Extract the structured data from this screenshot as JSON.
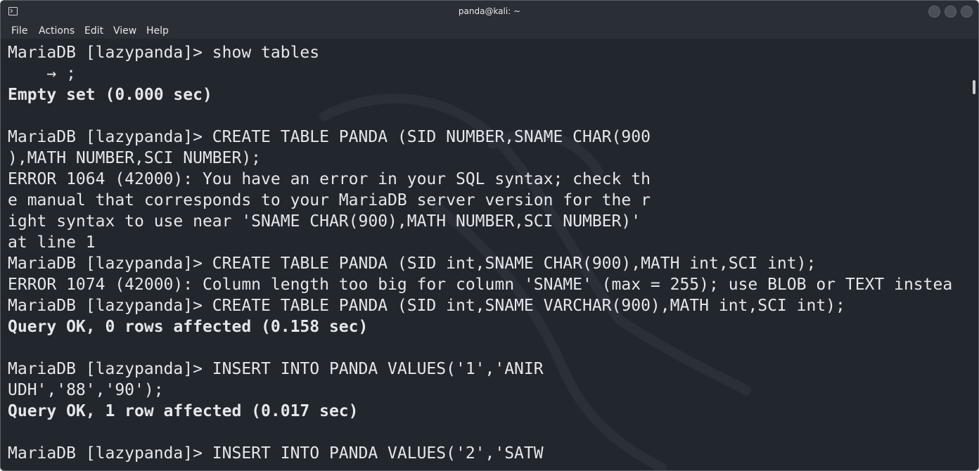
{
  "window": {
    "title": "panda@kali: ~"
  },
  "menu": [
    "File",
    "Actions",
    "Edit",
    "View",
    "Help"
  ],
  "terminal": {
    "lines": [
      {
        "text": "MariaDB [lazypanda]> show tables",
        "bold": false
      },
      {
        "text": "    → ;",
        "bold": false
      },
      {
        "text": "Empty set (0.000 sec)",
        "bold": true
      },
      {
        "text": "",
        "bold": false
      },
      {
        "text": "MariaDB [lazypanda]> CREATE TABLE PANDA (SID NUMBER,SNAME CHAR(900",
        "bold": false
      },
      {
        "text": "),MATH NUMBER,SCI NUMBER);",
        "bold": false
      },
      {
        "text": "ERROR 1064 (42000): You have an error in your SQL syntax; check th",
        "bold": false
      },
      {
        "text": "e manual that corresponds to your MariaDB server version for the r",
        "bold": false
      },
      {
        "text": "ight syntax to use near 'SNAME CHAR(900),MATH NUMBER,SCI NUMBER)'",
        "bold": false
      },
      {
        "text": "at line 1",
        "bold": false
      },
      {
        "text": "MariaDB [lazypanda]> CREATE TABLE PANDA (SID int,SNAME CHAR(900),MATH int,SCI int);",
        "bold": false
      },
      {
        "text": "ERROR 1074 (42000): Column length too big for column 'SNAME' (max = 255); use BLOB or TEXT instea",
        "bold": false
      },
      {
        "text": "MariaDB [lazypanda]> CREATE TABLE PANDA (SID int,SNAME VARCHAR(900),MATH int,SCI int);",
        "bold": false
      },
      {
        "text": "Query OK, 0 rows affected (0.158 sec)",
        "bold": true
      },
      {
        "text": "",
        "bold": false
      },
      {
        "text": "MariaDB [lazypanda]> INSERT INTO PANDA VALUES('1','ANIR",
        "bold": false
      },
      {
        "text": "UDH','88','90');",
        "bold": false
      },
      {
        "text": "Query OK, 1 row affected (0.017 sec)",
        "bold": true
      },
      {
        "text": "",
        "bold": false
      },
      {
        "text": "MariaDB [lazypanda]> INSERT INTO PANDA VALUES('2','SATW",
        "bold": false
      }
    ]
  },
  "icons": {
    "terminal": "terminal-icon",
    "minimize": "minimize-icon",
    "maximize": "maximize-icon",
    "close": "close-icon"
  },
  "colors": {
    "background": "#22262d",
    "text": "#e4e7eb",
    "titlebar": "#2a2e35"
  }
}
